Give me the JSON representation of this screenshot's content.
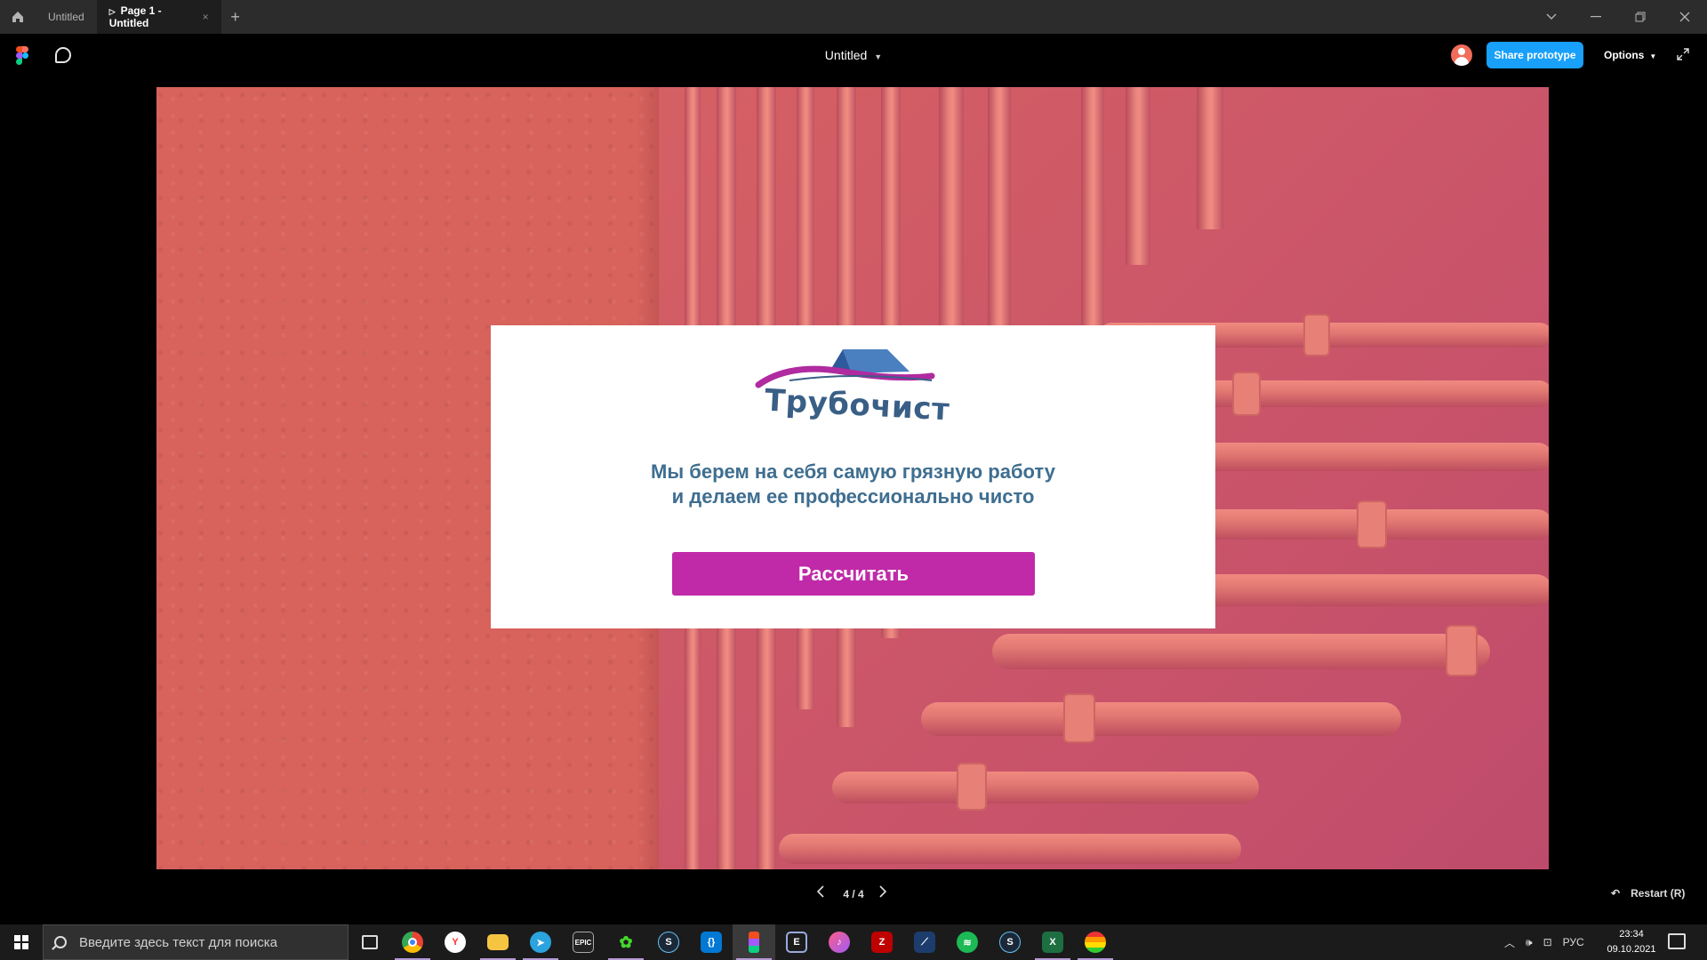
{
  "titlebar": {
    "tabs": [
      {
        "label": "Untitled",
        "active": false
      },
      {
        "label": "Page 1 - Untitled",
        "active": true
      }
    ],
    "home_icon": "home-icon",
    "new_tab_icon": "plus-icon",
    "close_tab_symbol": "×",
    "window_controls": [
      "chevron-down-icon",
      "minimize-icon",
      "restore-icon",
      "close-icon"
    ]
  },
  "toolbar": {
    "document_title": "Untitled",
    "share_label": "Share prototype",
    "options_label": "Options",
    "share_color": "#18a0fb"
  },
  "slide": {
    "logo_text": "Трубочист",
    "tagline_line1": "Мы берем на себя самую грязную работу",
    "tagline_line2": "и делаем ее профессионально чисто",
    "button_label": "Рассчитать",
    "button_color": "#c02aa8",
    "text_color": "#3f6e90",
    "background_color": "#d9645f"
  },
  "navigation": {
    "page_indicator": "4 / 4",
    "restart_label": "Restart (R)"
  },
  "taskbar": {
    "search_placeholder": "Введите здесь текст для поиска",
    "apps": [
      "task-view",
      "chrome",
      "yandex-browser",
      "file-explorer",
      "telegram",
      "epic-games",
      "razer",
      "steam",
      "vscode",
      "figma",
      "terminal",
      "itunes",
      "filezilla",
      "app-blue",
      "spotify",
      "steam",
      "excel",
      "color-app"
    ],
    "language": "РУС",
    "time": "23:34",
    "date": "09.10.2021"
  }
}
